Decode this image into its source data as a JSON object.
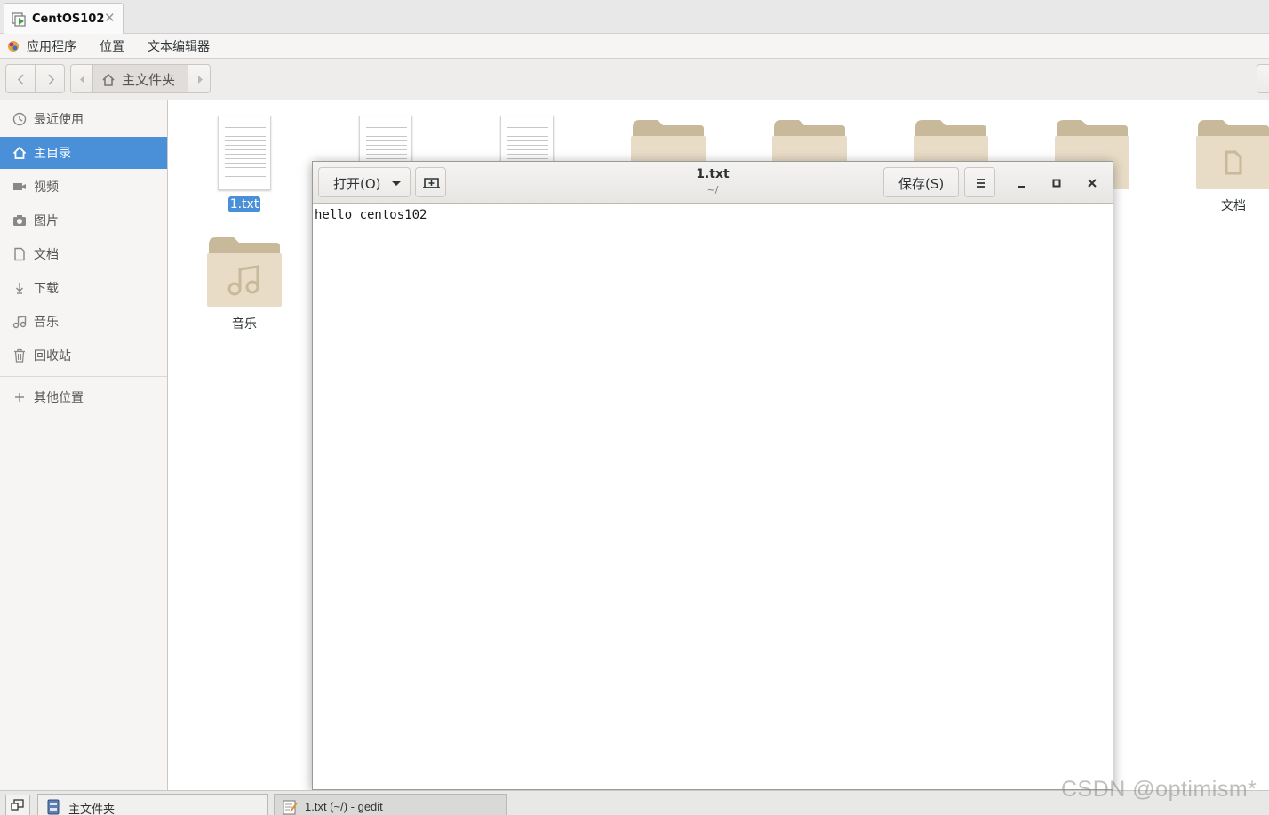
{
  "vm": {
    "tab_label": "CentOS102",
    "close_symbol": "✕"
  },
  "menubar": {
    "items": [
      "应用程序",
      "位置",
      "文本编辑器"
    ]
  },
  "nav": {
    "path_label": "主文件夹"
  },
  "sidebar": {
    "items": [
      {
        "label": "最近使用",
        "icon": "clock-icon"
      },
      {
        "label": "主目录",
        "icon": "home-icon",
        "active": true
      },
      {
        "label": "视频",
        "icon": "video-icon"
      },
      {
        "label": "图片",
        "icon": "camera-icon"
      },
      {
        "label": "文档",
        "icon": "document-icon"
      },
      {
        "label": "下载",
        "icon": "download-icon"
      },
      {
        "label": "音乐",
        "icon": "music-icon"
      },
      {
        "label": "回收站",
        "icon": "trash-icon"
      }
    ],
    "other_locations": "其他位置"
  },
  "files": {
    "items": [
      {
        "name": "1.txt",
        "type": "text",
        "selected": true
      },
      {
        "name": "",
        "type": "text"
      },
      {
        "name": "",
        "type": "text"
      },
      {
        "name": "",
        "type": "folder"
      },
      {
        "name": "",
        "type": "folder"
      },
      {
        "name": "",
        "type": "folder"
      },
      {
        "name": "",
        "type": "folder"
      },
      {
        "name": "文档",
        "type": "folder"
      },
      {
        "name": "音乐",
        "type": "folder"
      }
    ]
  },
  "gedit": {
    "open_label": "打开(O)",
    "save_label": "保存(S)",
    "title": "1.txt",
    "subtitle": "~/",
    "content": "hello centos102"
  },
  "taskbar": {
    "items": [
      {
        "label": "主文件夹"
      },
      {
        "label": "1.txt (~/) - gedit",
        "active": true
      }
    ]
  },
  "watermark": "CSDN @optimism*",
  "colors": {
    "accent": "#4a90d9",
    "folder": "#c8b99a",
    "folder_body": "#e8dcc6"
  }
}
